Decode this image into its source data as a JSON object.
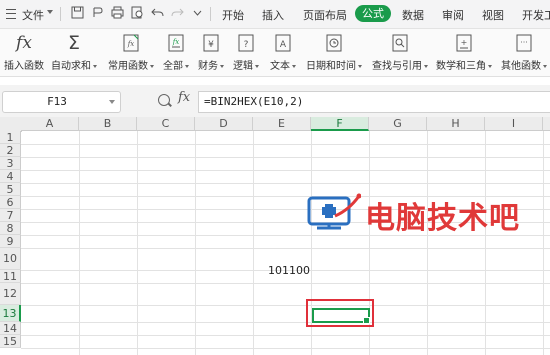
{
  "menu": {
    "file_label": "文件"
  },
  "tabs": [
    {
      "label": "开始"
    },
    {
      "label": "插入"
    },
    {
      "label": "页面布局"
    },
    {
      "label": "公式"
    },
    {
      "label": "数据"
    },
    {
      "label": "审阅"
    },
    {
      "label": "视图"
    },
    {
      "label": "开发工"
    }
  ],
  "active_tab_color": "#1a9b4b",
  "toolbar": [
    {
      "label": "插入函数",
      "icon": "fx-icon"
    },
    {
      "label": "自动求和",
      "icon": "sigma-icon"
    },
    {
      "label": "常用函数",
      "icon": "star-function-icon"
    },
    {
      "label": "全部",
      "icon": "function-list-icon"
    },
    {
      "label": "财务",
      "icon": "finance-book-icon"
    },
    {
      "label": "逻辑",
      "icon": "logic-question-icon"
    },
    {
      "label": "文本",
      "icon": "text-a-icon"
    },
    {
      "label": "日期和时间",
      "icon": "clock-icon"
    },
    {
      "label": "查找与引用",
      "icon": "lookup-icon"
    },
    {
      "label": "数学和三角",
      "icon": "math-icon"
    },
    {
      "label": "其他函数",
      "icon": "more-functions-icon"
    }
  ],
  "formula_bar": {
    "name_box": "F13",
    "fx": "fx",
    "formula": "=BIN2HEX(E10,2)"
  },
  "columns": [
    "A",
    "B",
    "C",
    "D",
    "E",
    "F",
    "G",
    "H",
    "I"
  ],
  "rows": [
    "1",
    "2",
    "3",
    "4",
    "5",
    "6",
    "7",
    "8",
    "9",
    "10",
    "11",
    "12",
    "13",
    "14",
    "15"
  ],
  "selected_cell": {
    "column": "F",
    "row": "13"
  },
  "cells": {
    "E10": "101100"
  },
  "watermark": {
    "text": "电脑技术吧"
  }
}
